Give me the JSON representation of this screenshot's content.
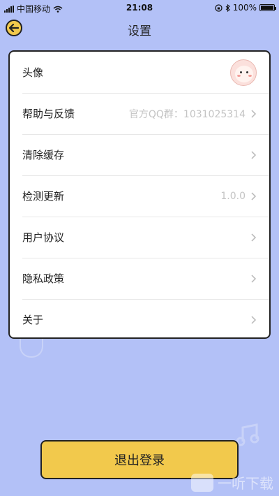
{
  "status_bar": {
    "carrier": "中国移动",
    "time": "21:08",
    "battery_text": "100%",
    "battery_level": 1.0
  },
  "nav": {
    "title": "设置",
    "back_icon": "arrow-left-icon"
  },
  "settings": {
    "items": [
      {
        "label": "头像",
        "value": ""
      },
      {
        "label": "帮助与反馈",
        "value": "官方QQ群：1031025314"
      },
      {
        "label": "清除缓存",
        "value": ""
      },
      {
        "label": "检测更新",
        "value": "1.0.0"
      },
      {
        "label": "用户协议",
        "value": ""
      },
      {
        "label": "隐私政策",
        "value": ""
      },
      {
        "label": "关于",
        "value": ""
      }
    ]
  },
  "logout_label": "退出登录",
  "watermark": "一听下载",
  "colors": {
    "background": "#b3c1f7",
    "accent": "#f2c94c",
    "card": "#ffffff",
    "value_text": "#c4c4c4"
  }
}
